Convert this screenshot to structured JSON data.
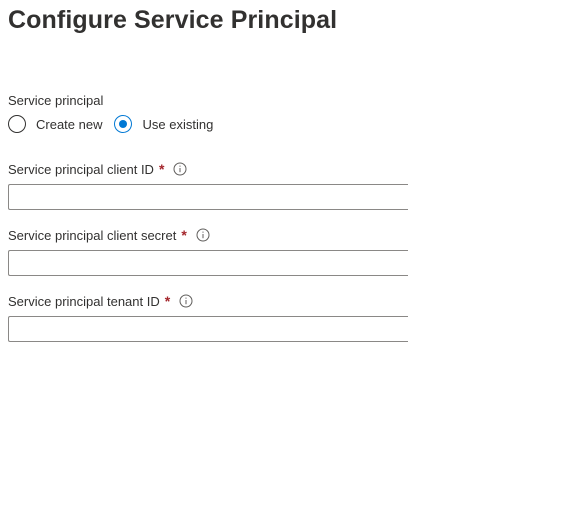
{
  "header": {
    "title": "Configure Service Principal"
  },
  "service_principal": {
    "label": "Service principal",
    "options": [
      {
        "label": "Create new",
        "selected": false
      },
      {
        "label": "Use existing",
        "selected": true
      }
    ]
  },
  "fields": {
    "client_id": {
      "label": "Service principal client ID",
      "required_marker": "*",
      "value": "",
      "placeholder": ""
    },
    "client_secret": {
      "label": "Service principal client secret",
      "required_marker": "*",
      "value": "",
      "placeholder": ""
    },
    "tenant_id": {
      "label": "Service principal tenant ID",
      "required_marker": "*",
      "value": "",
      "placeholder": ""
    }
  },
  "colors": {
    "accent": "#0078d4",
    "required": "#a4262c",
    "text": "#323130",
    "input_border": "#8a8886"
  },
  "icons": {
    "info": "info-icon"
  }
}
